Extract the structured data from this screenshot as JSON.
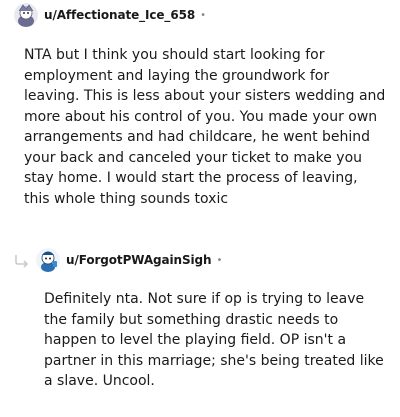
{
  "comments": [
    {
      "username": "u/Affectionate_Ice_658",
      "separator": "•",
      "avatar_icon": "snoo-avatar-icon",
      "text": "NTA but I think you should start looking for employment and laying the groundwork for leaving. This is less about your sisters wedding and more about his control of you. You made your own arrangements and had childcare, he went behind your back and canceled your ticket to make you stay home. I would start the process of leaving, this whole thing sounds toxic"
    },
    {
      "username": "u/ForgotPWAgainSigh",
      "separator": "•",
      "avatar_icon": "snoo-avatar-icon",
      "reply_icon": "reply-arrow-icon",
      "text": "Definitely nta. Not sure if op is trying to leave the family but something drastic needs to happen to level the playing field. OP isn't a partner in this marriage; she's being treated like a slave. Uncool."
    }
  ],
  "colors": {
    "text": "#1a1a1b",
    "meta": "#878a8c",
    "reply_arrow": "#c8cbcd"
  }
}
